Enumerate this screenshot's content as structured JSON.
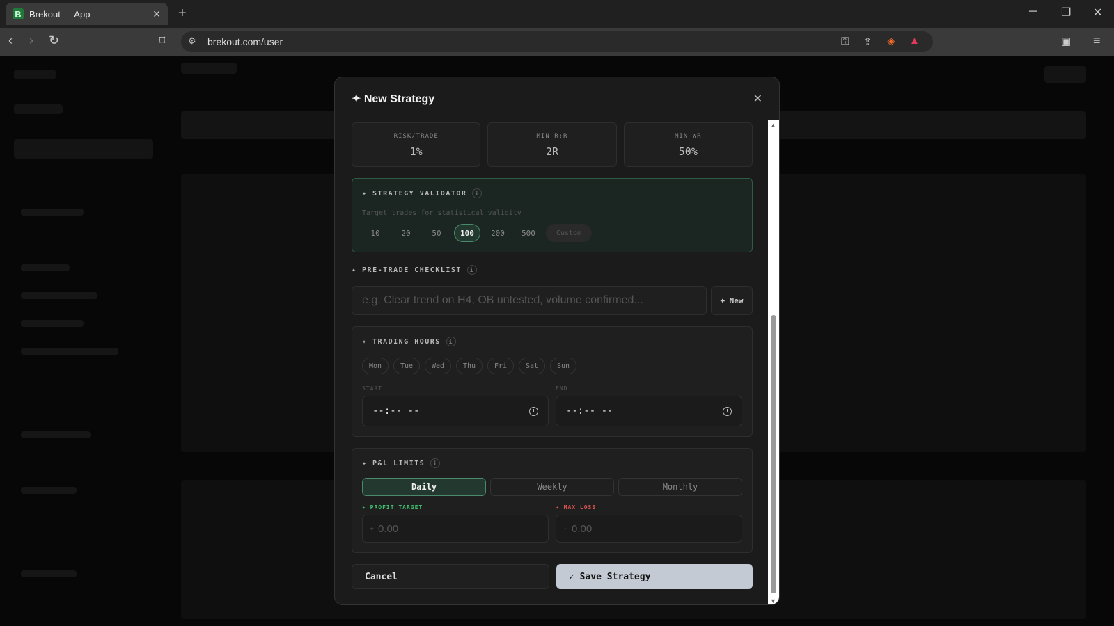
{
  "browser": {
    "tab_title": "Brekout — App",
    "favicon_letter": "B",
    "tab_close": "✕",
    "new_tab": "+",
    "url": "brekout.com/user",
    "win_min": "─",
    "win_max": "❐",
    "win_close": "✕"
  },
  "modal": {
    "title": "✦ New Strategy",
    "close": "✕",
    "stats": [
      {
        "label": "RISK/TRADE",
        "value": "1%"
      },
      {
        "label": "MIN R:R",
        "value": "2R"
      },
      {
        "label": "MIN WR",
        "value": "50%"
      }
    ],
    "validator": {
      "title": "✦ STRATEGY VALIDATOR",
      "info": "i",
      "subtitle": "Target trades for statistical validity",
      "options": [
        "10",
        "20",
        "50",
        "100",
        "200",
        "500"
      ],
      "active": "100",
      "custom_placeholder": "Custom"
    },
    "checklist": {
      "title": "✦ PRE-TRADE CHECKLIST",
      "info": "i",
      "placeholder": "e.g. Clear trend on H4, OB untested, volume confirmed...",
      "new_label": "+ New"
    },
    "hours": {
      "title": "✦ TRADING HOURS",
      "info": "i",
      "days": [
        "Mon",
        "Tue",
        "Wed",
        "Thu",
        "Fri",
        "Sat",
        "Sun"
      ],
      "start_label": "START",
      "end_label": "END",
      "start_value": "--:-- --",
      "end_value": "--:-- --"
    },
    "pnl": {
      "title": "✦ P&L LIMITS",
      "info": "i",
      "periods": [
        "Daily",
        "Weekly",
        "Monthly"
      ],
      "active": "Daily",
      "profit_label": "✦ PROFIT TARGET",
      "loss_label": "✦ MAX LOSS",
      "profit_sign": "+",
      "loss_sign": "-",
      "profit_placeholder": "0.00",
      "loss_placeholder": "0.00"
    },
    "cancel_label": "Cancel",
    "save_label": "✓  Save Strategy"
  },
  "colors": {
    "accent_green": "#4a8a6a",
    "profit_green": "#3fbf6f",
    "loss_red": "#d9534f",
    "save_bg": "#c4cad3"
  }
}
